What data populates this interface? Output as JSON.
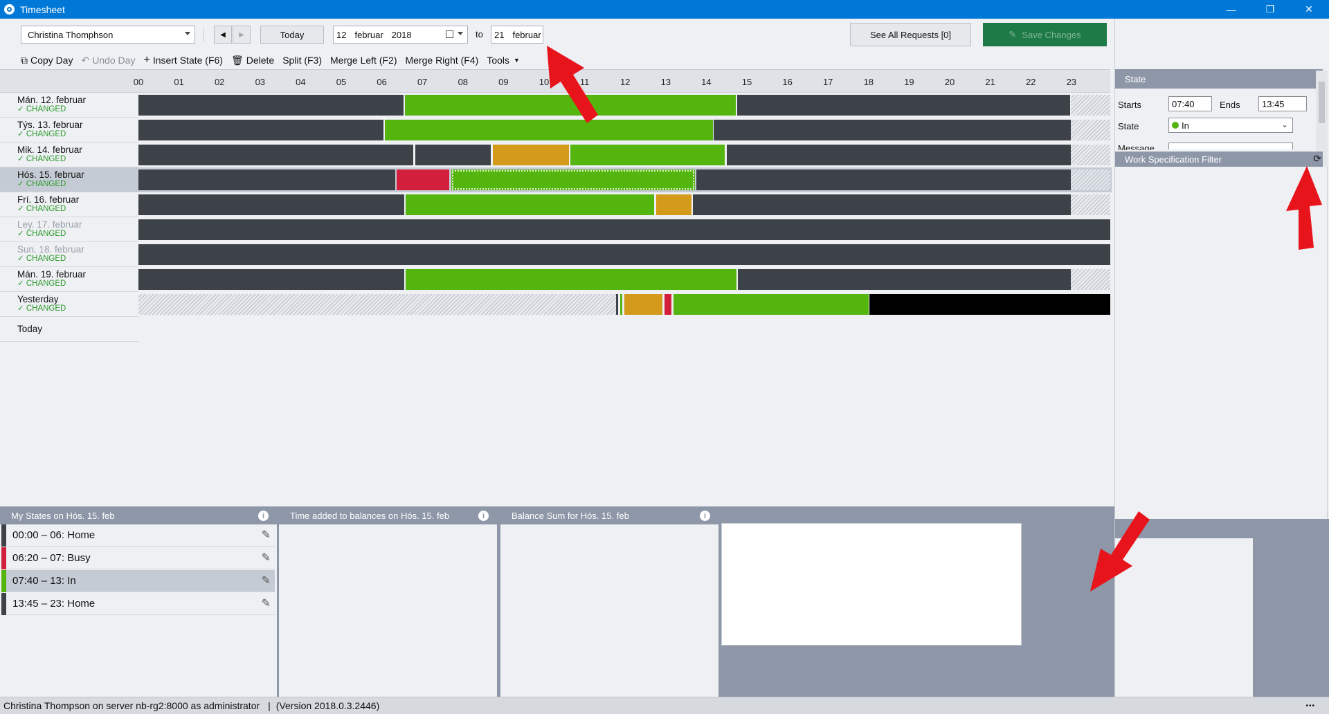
{
  "window": {
    "title": "Timesheet",
    "minimize": "—",
    "restore": "❐",
    "close": "✕"
  },
  "toolbar": {
    "employee": "Christina Thomphson",
    "today_label": "Today",
    "date_from": {
      "day": "12",
      "month": "februar",
      "year": "2018"
    },
    "to_label": "to",
    "date_to": {
      "day": "21",
      "month": "februar"
    },
    "see_all_requests": "See All Requests [0]",
    "save_changes": "Save Changes",
    "prev_icon": "◀",
    "next_icon": "▶"
  },
  "actions": {
    "copy_day": "Copy Day",
    "undo_day": "Undo Day",
    "insert_state": "Insert State (F6)",
    "delete": "Delete",
    "split": "Split (F3)",
    "merge_left": "Merge Left (F2)",
    "merge_right": "Merge Right (F4)",
    "tools": "Tools"
  },
  "hours": [
    "00",
    "01",
    "02",
    "03",
    "04",
    "05",
    "06",
    "07",
    "08",
    "09",
    "10",
    "11",
    "12",
    "13",
    "14",
    "15",
    "16",
    "17",
    "18",
    "19",
    "20",
    "21",
    "22",
    "23"
  ],
  "colors": {
    "home": "#3d4249",
    "in": "#55b50f",
    "busy": "#d21f3c",
    "break": "#d49a1a",
    "away": "#000000",
    "accent": "#0078d7",
    "save": "#1e7a47"
  },
  "days": [
    {
      "name": "Mán. 12. februar",
      "status": "✓ CHANGED",
      "dim": false,
      "selected": false
    },
    {
      "name": "Týs. 13. februar",
      "status": "✓ CHANGED",
      "dim": false,
      "selected": false
    },
    {
      "name": "Mik. 14. februar",
      "status": "✓ CHANGED",
      "dim": false,
      "selected": false
    },
    {
      "name": "Hós. 15. februar",
      "status": "✓ CHANGED",
      "dim": false,
      "selected": true
    },
    {
      "name": "Frí. 16. februar",
      "status": "✓ CHANGED",
      "dim": false,
      "selected": false
    },
    {
      "name": "Ley. 17. februar",
      "status": "✓ CHANGED",
      "dim": true,
      "selected": false
    },
    {
      "name": "Sun. 18. februar",
      "status": "✓ CHANGED",
      "dim": true,
      "selected": false
    },
    {
      "name": "Mán. 19. februar",
      "status": "✓ CHANGED",
      "dim": false,
      "selected": false
    },
    {
      "name": "Yesterday",
      "status": "✓ CHANGED",
      "dim": false,
      "selected": false
    },
    {
      "name": "Today",
      "status": "",
      "dim": false,
      "selected": false
    }
  ],
  "state_panel": {
    "header": "State",
    "starts_label": "Starts",
    "starts_value": "07:40",
    "ends_label": "Ends",
    "ends_value": "13:45",
    "state_label": "State",
    "state_value": "In",
    "message_label": "Message"
  },
  "filter_panel": {
    "header": "Work Specification Filter"
  },
  "bottom": {
    "my_states_header": "My States on Hós. 15. feb",
    "balances_header": "Time added to balances on Hós. 15. feb",
    "balance_sum_header": "Balance Sum for Hós. 15. feb",
    "states": [
      {
        "text": "00:00 – 06:  Home",
        "color": "#3d4249"
      },
      {
        "text": "06:20 – 07:  Busy",
        "color": "#d21f3c"
      },
      {
        "text": "07:40 – 13:  In",
        "color": "#55b50f"
      },
      {
        "text": "13:45 – 23:  Home",
        "color": "#3d4249"
      }
    ]
  },
  "statusbar": {
    "user": "Christina Thompson on server nb-rg2:8000 as administrator",
    "separator": "|",
    "version": "(Version 2018.0.3.2446)",
    "more": "•••"
  }
}
